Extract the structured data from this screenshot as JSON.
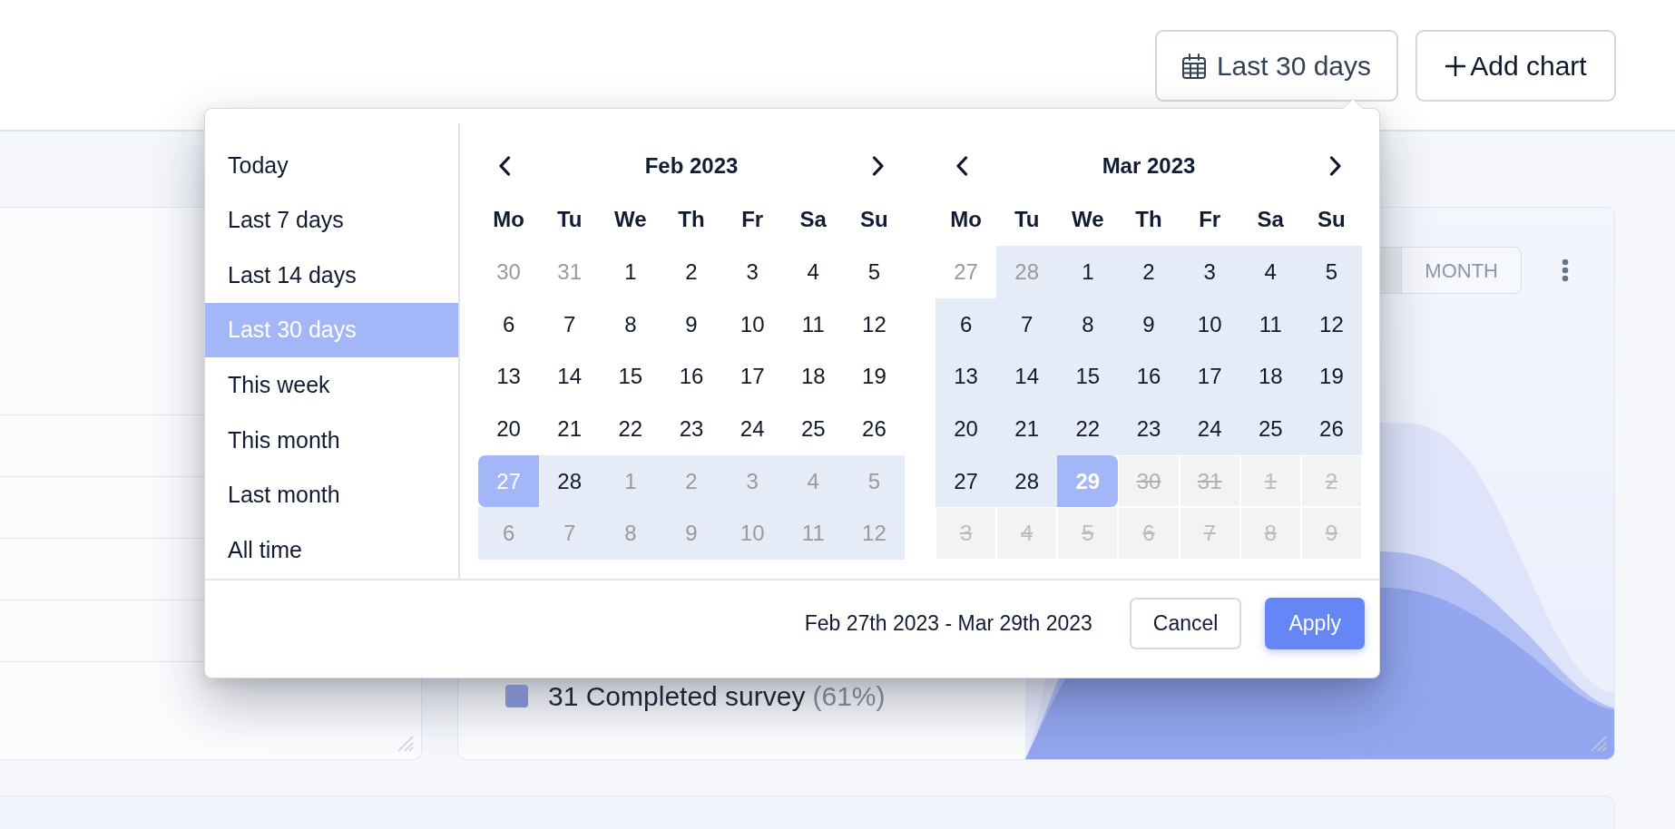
{
  "header": {
    "buttons": [
      {
        "kind": "date_range",
        "label": "Last 30 days"
      },
      {
        "kind": "add",
        "label": "Add chart"
      }
    ]
  },
  "date_picker": {
    "presets": [
      {
        "label": "Today",
        "selected": false
      },
      {
        "label": "Last 7 days",
        "selected": false
      },
      {
        "label": "Last 14 days",
        "selected": false
      },
      {
        "label": "Last 30 days",
        "selected": true
      },
      {
        "label": "This week",
        "selected": false
      },
      {
        "label": "This month",
        "selected": false
      },
      {
        "label": "Last month",
        "selected": false
      },
      {
        "label": "All time",
        "selected": false
      }
    ],
    "calendars": [
      {
        "title": "Feb 2023",
        "weekdays": [
          "Mo",
          "Tu",
          "We",
          "Th",
          "Fr",
          "Sa",
          "Su"
        ],
        "weeks": [
          [
            {
              "label": "30",
              "outside": true,
              "in_range": false,
              "selected": false,
              "disabled": false,
              "today": false
            },
            {
              "label": "31",
              "outside": true,
              "in_range": false,
              "selected": false,
              "disabled": false,
              "today": false
            },
            {
              "label": "1",
              "outside": false,
              "in_range": false,
              "selected": false,
              "disabled": false,
              "today": false
            },
            {
              "label": "2",
              "outside": false,
              "in_range": false,
              "selected": false,
              "disabled": false,
              "today": false
            },
            {
              "label": "3",
              "outside": false,
              "in_range": false,
              "selected": false,
              "disabled": false,
              "today": false
            },
            {
              "label": "4",
              "outside": false,
              "in_range": false,
              "selected": false,
              "disabled": false,
              "today": false
            },
            {
              "label": "5",
              "outside": false,
              "in_range": false,
              "selected": false,
              "disabled": false,
              "today": false
            }
          ],
          [
            {
              "label": "6",
              "outside": false,
              "in_range": false,
              "selected": false,
              "disabled": false,
              "today": false
            },
            {
              "label": "7",
              "outside": false,
              "in_range": false,
              "selected": false,
              "disabled": false,
              "today": false
            },
            {
              "label": "8",
              "outside": false,
              "in_range": false,
              "selected": false,
              "disabled": false,
              "today": false
            },
            {
              "label": "9",
              "outside": false,
              "in_range": false,
              "selected": false,
              "disabled": false,
              "today": false
            },
            {
              "label": "10",
              "outside": false,
              "in_range": false,
              "selected": false,
              "disabled": false,
              "today": false
            },
            {
              "label": "11",
              "outside": false,
              "in_range": false,
              "selected": false,
              "disabled": false,
              "today": false
            },
            {
              "label": "12",
              "outside": false,
              "in_range": false,
              "selected": false,
              "disabled": false,
              "today": false
            }
          ],
          [
            {
              "label": "13",
              "outside": false,
              "in_range": false,
              "selected": false,
              "disabled": false,
              "today": false
            },
            {
              "label": "14",
              "outside": false,
              "in_range": false,
              "selected": false,
              "disabled": false,
              "today": false
            },
            {
              "label": "15",
              "outside": false,
              "in_range": false,
              "selected": false,
              "disabled": false,
              "today": false
            },
            {
              "label": "16",
              "outside": false,
              "in_range": false,
              "selected": false,
              "disabled": false,
              "today": false
            },
            {
              "label": "17",
              "outside": false,
              "in_range": false,
              "selected": false,
              "disabled": false,
              "today": false
            },
            {
              "label": "18",
              "outside": false,
              "in_range": false,
              "selected": false,
              "disabled": false,
              "today": false
            },
            {
              "label": "19",
              "outside": false,
              "in_range": false,
              "selected": false,
              "disabled": false,
              "today": false
            }
          ],
          [
            {
              "label": "20",
              "outside": false,
              "in_range": false,
              "selected": false,
              "disabled": false,
              "today": false
            },
            {
              "label": "21",
              "outside": false,
              "in_range": false,
              "selected": false,
              "disabled": false,
              "today": false
            },
            {
              "label": "22",
              "outside": false,
              "in_range": false,
              "selected": false,
              "disabled": false,
              "today": false
            },
            {
              "label": "23",
              "outside": false,
              "in_range": false,
              "selected": false,
              "disabled": false,
              "today": false
            },
            {
              "label": "24",
              "outside": false,
              "in_range": false,
              "selected": false,
              "disabled": false,
              "today": false
            },
            {
              "label": "25",
              "outside": false,
              "in_range": false,
              "selected": false,
              "disabled": false,
              "today": false
            },
            {
              "label": "26",
              "outside": false,
              "in_range": false,
              "selected": false,
              "disabled": false,
              "today": false
            }
          ],
          [
            {
              "label": "27",
              "outside": false,
              "in_range": true,
              "selected": true,
              "disabled": false,
              "today": false
            },
            {
              "label": "28",
              "outside": false,
              "in_range": true,
              "selected": false,
              "disabled": false,
              "today": false
            },
            {
              "label": "1",
              "outside": true,
              "in_range": true,
              "selected": false,
              "disabled": false,
              "today": false
            },
            {
              "label": "2",
              "outside": true,
              "in_range": true,
              "selected": false,
              "disabled": false,
              "today": false
            },
            {
              "label": "3",
              "outside": true,
              "in_range": true,
              "selected": false,
              "disabled": false,
              "today": false
            },
            {
              "label": "4",
              "outside": true,
              "in_range": true,
              "selected": false,
              "disabled": false,
              "today": false
            },
            {
              "label": "5",
              "outside": true,
              "in_range": true,
              "selected": false,
              "disabled": false,
              "today": false
            }
          ],
          [
            {
              "label": "6",
              "outside": true,
              "in_range": true,
              "selected": false,
              "disabled": false,
              "today": false
            },
            {
              "label": "7",
              "outside": true,
              "in_range": true,
              "selected": false,
              "disabled": false,
              "today": false
            },
            {
              "label": "8",
              "outside": true,
              "in_range": true,
              "selected": false,
              "disabled": false,
              "today": false
            },
            {
              "label": "9",
              "outside": true,
              "in_range": true,
              "selected": false,
              "disabled": false,
              "today": false
            },
            {
              "label": "10",
              "outside": true,
              "in_range": true,
              "selected": false,
              "disabled": false,
              "today": false
            },
            {
              "label": "11",
              "outside": true,
              "in_range": true,
              "selected": false,
              "disabled": false,
              "today": false
            },
            {
              "label": "12",
              "outside": true,
              "in_range": true,
              "selected": false,
              "disabled": false,
              "today": false
            }
          ]
        ]
      },
      {
        "title": "Mar 2023",
        "weekdays": [
          "Mo",
          "Tu",
          "We",
          "Th",
          "Fr",
          "Sa",
          "Su"
        ],
        "weeks": [
          [
            {
              "label": "27",
              "outside": true,
              "in_range": false,
              "selected": false,
              "disabled": false,
              "today": false
            },
            {
              "label": "28",
              "outside": true,
              "in_range": true,
              "selected": false,
              "disabled": false,
              "today": false
            },
            {
              "label": "1",
              "outside": false,
              "in_range": true,
              "selected": false,
              "disabled": false,
              "today": false
            },
            {
              "label": "2",
              "outside": false,
              "in_range": true,
              "selected": false,
              "disabled": false,
              "today": false
            },
            {
              "label": "3",
              "outside": false,
              "in_range": true,
              "selected": false,
              "disabled": false,
              "today": false
            },
            {
              "label": "4",
              "outside": false,
              "in_range": true,
              "selected": false,
              "disabled": false,
              "today": false
            },
            {
              "label": "5",
              "outside": false,
              "in_range": true,
              "selected": false,
              "disabled": false,
              "today": false
            }
          ],
          [
            {
              "label": "6",
              "outside": false,
              "in_range": true,
              "selected": false,
              "disabled": false,
              "today": false
            },
            {
              "label": "7",
              "outside": false,
              "in_range": true,
              "selected": false,
              "disabled": false,
              "today": false
            },
            {
              "label": "8",
              "outside": false,
              "in_range": true,
              "selected": false,
              "disabled": false,
              "today": false
            },
            {
              "label": "9",
              "outside": false,
              "in_range": true,
              "selected": false,
              "disabled": false,
              "today": false
            },
            {
              "label": "10",
              "outside": false,
              "in_range": true,
              "selected": false,
              "disabled": false,
              "today": false
            },
            {
              "label": "11",
              "outside": false,
              "in_range": true,
              "selected": false,
              "disabled": false,
              "today": false
            },
            {
              "label": "12",
              "outside": false,
              "in_range": true,
              "selected": false,
              "disabled": false,
              "today": false
            }
          ],
          [
            {
              "label": "13",
              "outside": false,
              "in_range": true,
              "selected": false,
              "disabled": false,
              "today": false
            },
            {
              "label": "14",
              "outside": false,
              "in_range": true,
              "selected": false,
              "disabled": false,
              "today": false
            },
            {
              "label": "15",
              "outside": false,
              "in_range": true,
              "selected": false,
              "disabled": false,
              "today": false
            },
            {
              "label": "16",
              "outside": false,
              "in_range": true,
              "selected": false,
              "disabled": false,
              "today": false
            },
            {
              "label": "17",
              "outside": false,
              "in_range": true,
              "selected": false,
              "disabled": false,
              "today": false
            },
            {
              "label": "18",
              "outside": false,
              "in_range": true,
              "selected": false,
              "disabled": false,
              "today": false
            },
            {
              "label": "19",
              "outside": false,
              "in_range": true,
              "selected": false,
              "disabled": false,
              "today": false
            }
          ],
          [
            {
              "label": "20",
              "outside": false,
              "in_range": true,
              "selected": false,
              "disabled": false,
              "today": false
            },
            {
              "label": "21",
              "outside": false,
              "in_range": true,
              "selected": false,
              "disabled": false,
              "today": false
            },
            {
              "label": "22",
              "outside": false,
              "in_range": true,
              "selected": false,
              "disabled": false,
              "today": false
            },
            {
              "label": "23",
              "outside": false,
              "in_range": true,
              "selected": false,
              "disabled": false,
              "today": false
            },
            {
              "label": "24",
              "outside": false,
              "in_range": true,
              "selected": false,
              "disabled": false,
              "today": false
            },
            {
              "label": "25",
              "outside": false,
              "in_range": true,
              "selected": false,
              "disabled": false,
              "today": false
            },
            {
              "label": "26",
              "outside": false,
              "in_range": true,
              "selected": false,
              "disabled": false,
              "today": false
            }
          ],
          [
            {
              "label": "27",
              "outside": false,
              "in_range": true,
              "selected": false,
              "disabled": false,
              "today": false
            },
            {
              "label": "28",
              "outside": false,
              "in_range": true,
              "selected": false,
              "disabled": false,
              "today": false
            },
            {
              "label": "29",
              "outside": false,
              "in_range": true,
              "selected": true,
              "disabled": false,
              "today": true
            },
            {
              "label": "30",
              "outside": false,
              "in_range": false,
              "selected": false,
              "disabled": true,
              "today": false
            },
            {
              "label": "31",
              "outside": false,
              "in_range": false,
              "selected": false,
              "disabled": true,
              "today": false
            },
            {
              "label": "1",
              "outside": true,
              "in_range": false,
              "selected": false,
              "disabled": true,
              "today": false
            },
            {
              "label": "2",
              "outside": true,
              "in_range": false,
              "selected": false,
              "disabled": true,
              "today": false
            }
          ],
          [
            {
              "label": "3",
              "outside": true,
              "in_range": false,
              "selected": false,
              "disabled": true,
              "today": false
            },
            {
              "label": "4",
              "outside": true,
              "in_range": false,
              "selected": false,
              "disabled": true,
              "today": false
            },
            {
              "label": "5",
              "outside": true,
              "in_range": false,
              "selected": false,
              "disabled": true,
              "today": false
            },
            {
              "label": "6",
              "outside": true,
              "in_range": false,
              "selected": false,
              "disabled": true,
              "today": false
            },
            {
              "label": "7",
              "outside": true,
              "in_range": false,
              "selected": false,
              "disabled": true,
              "today": false
            },
            {
              "label": "8",
              "outside": true,
              "in_range": false,
              "selected": false,
              "disabled": true,
              "today": false
            },
            {
              "label": "9",
              "outside": true,
              "in_range": false,
              "selected": false,
              "disabled": true,
              "today": false
            }
          ]
        ]
      }
    ],
    "range_text": "Feb 27th 2023 - Mar 29th 2023",
    "buttons": [
      {
        "kind": "secondary",
        "label": "Cancel"
      },
      {
        "kind": "primary",
        "label": "Apply"
      }
    ]
  },
  "dashboard": {
    "legend": [
      {
        "label": "31 Completed survey",
        "percent": "(61%)",
        "color": "#7b89c4"
      }
    ],
    "chart_panel": {
      "period_tabs": [
        {
          "selected": true
        },
        {
          "label": "MONTH",
          "selected": false
        }
      ]
    }
  }
}
